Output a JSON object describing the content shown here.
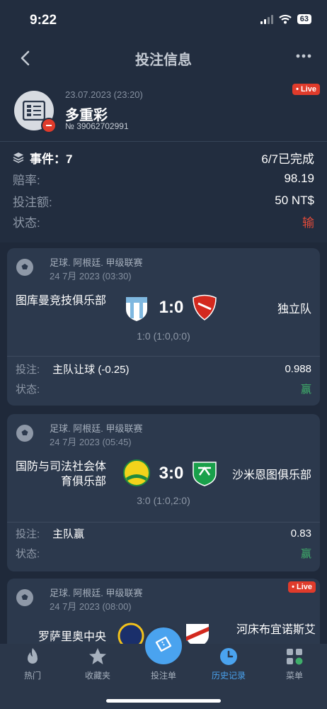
{
  "status_bar": {
    "time": "9:22",
    "battery": "63"
  },
  "nav": {
    "title": "投注信息",
    "back_icon": "chevron-left-icon",
    "more_icon": "more-dots-icon"
  },
  "bet": {
    "date": "23.07.2023 (23:20)",
    "type": "多重彩",
    "number": "№ 39062702991",
    "live": "• Live"
  },
  "summary": {
    "events_label": "事件：7",
    "events_value": "6/7已完成",
    "odds_label": "赔率:",
    "odds_value": "98.19",
    "stake_label": "投注额:",
    "stake_value": "50 NT$",
    "status_label": "状态:",
    "status_value": "输"
  },
  "events": [
    {
      "league": "足球. 阿根廷. 甲级联赛",
      "date": "24 7月 2023 (03:30)",
      "home": "图库曼竞技俱乐部",
      "away": "独立队",
      "score": "1:0",
      "halftime": "1:0 (1:0,0:0)",
      "bet_label": "投注:",
      "pick": "主队让球 (-0.25)",
      "odds": "0.988",
      "status_label": "状态:",
      "status": "赢"
    },
    {
      "league": "足球. 阿根廷. 甲级联赛",
      "date": "24 7月 2023 (05:45)",
      "home": "国防与司法社会体育俱乐部",
      "away": "沙米恩图俱乐部",
      "score": "3:0",
      "halftime": "3:0 (1:0,2:0)",
      "bet_label": "投注:",
      "pick": "主队赢",
      "odds": "0.83",
      "status_label": "状态:",
      "status": "赢"
    },
    {
      "league": "足球. 阿根廷. 甲级联赛",
      "date": "24 7月 2023 (08:00)",
      "home": "罗萨里奥中央",
      "away": "河床布宜诺斯艾",
      "live": "• Live"
    }
  ],
  "tabs": [
    {
      "label": "热门",
      "icon": "flame-icon"
    },
    {
      "label": "收藏夹",
      "icon": "star-icon"
    },
    {
      "label": "投注单",
      "icon": "ticket-icon"
    },
    {
      "label": "历史记录",
      "icon": "clock-icon"
    },
    {
      "label": "菜单",
      "icon": "menu-grid-icon"
    }
  ],
  "colors": {
    "accent": "#4aa3ef",
    "live": "#e03b2b",
    "won": "#3fae6a",
    "lost": "#e24b3a",
    "background": "#222d3f"
  }
}
